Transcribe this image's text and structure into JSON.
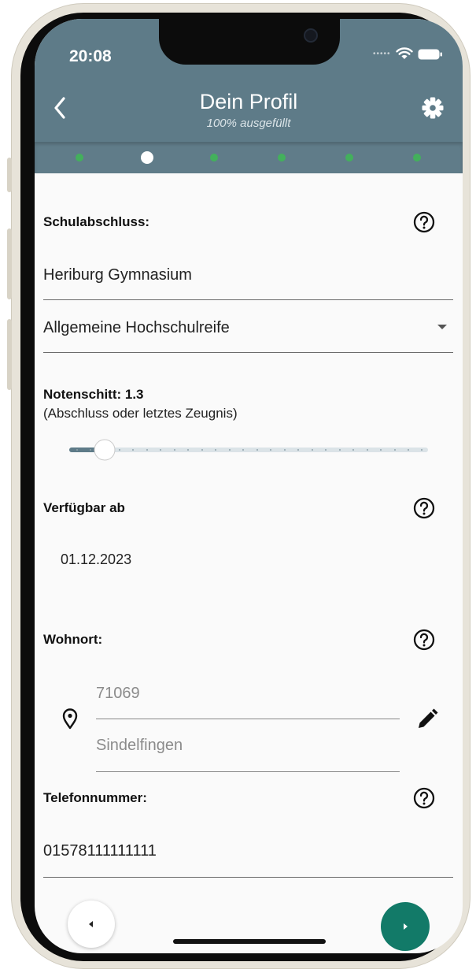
{
  "status_bar": {
    "time": "20:08"
  },
  "header": {
    "title": "Dein Profil",
    "subtitle": "100% ausgefüllt",
    "progress_steps": 6,
    "active_step": 2,
    "colors": {
      "header": "#5e7b88",
      "step_done": "#43b05c",
      "step_active": "#ffffff"
    }
  },
  "education": {
    "label": "Schulabschluss:",
    "school": "Heriburg Gymnasium",
    "degree": "Allgemeine Hochschulreife"
  },
  "grade": {
    "label": "Notenschitt: 1.3",
    "hint": "(Abschluss oder letztes Zeugnis)",
    "slider_value": 1.3,
    "slider_min": 1.0,
    "slider_max": 6.0
  },
  "availability": {
    "label": "Verfügbar ab",
    "date": "01.12.2023"
  },
  "residence": {
    "label": "Wohnort:",
    "postal_code_placeholder": "71069",
    "city_placeholder": "Sindelfingen"
  },
  "phone": {
    "label": "Telefonnummer:",
    "number": "01578111111111"
  },
  "icons": {
    "back": "chevron-left-icon",
    "settings": "gear-icon",
    "help": "help-circle-icon",
    "dropdown": "caret-down-icon",
    "location": "map-pin-icon",
    "edit": "pencil-icon",
    "previous": "caret-left-icon",
    "next": "caret-right-icon"
  },
  "accent": {
    "next_button": "#127a68"
  }
}
